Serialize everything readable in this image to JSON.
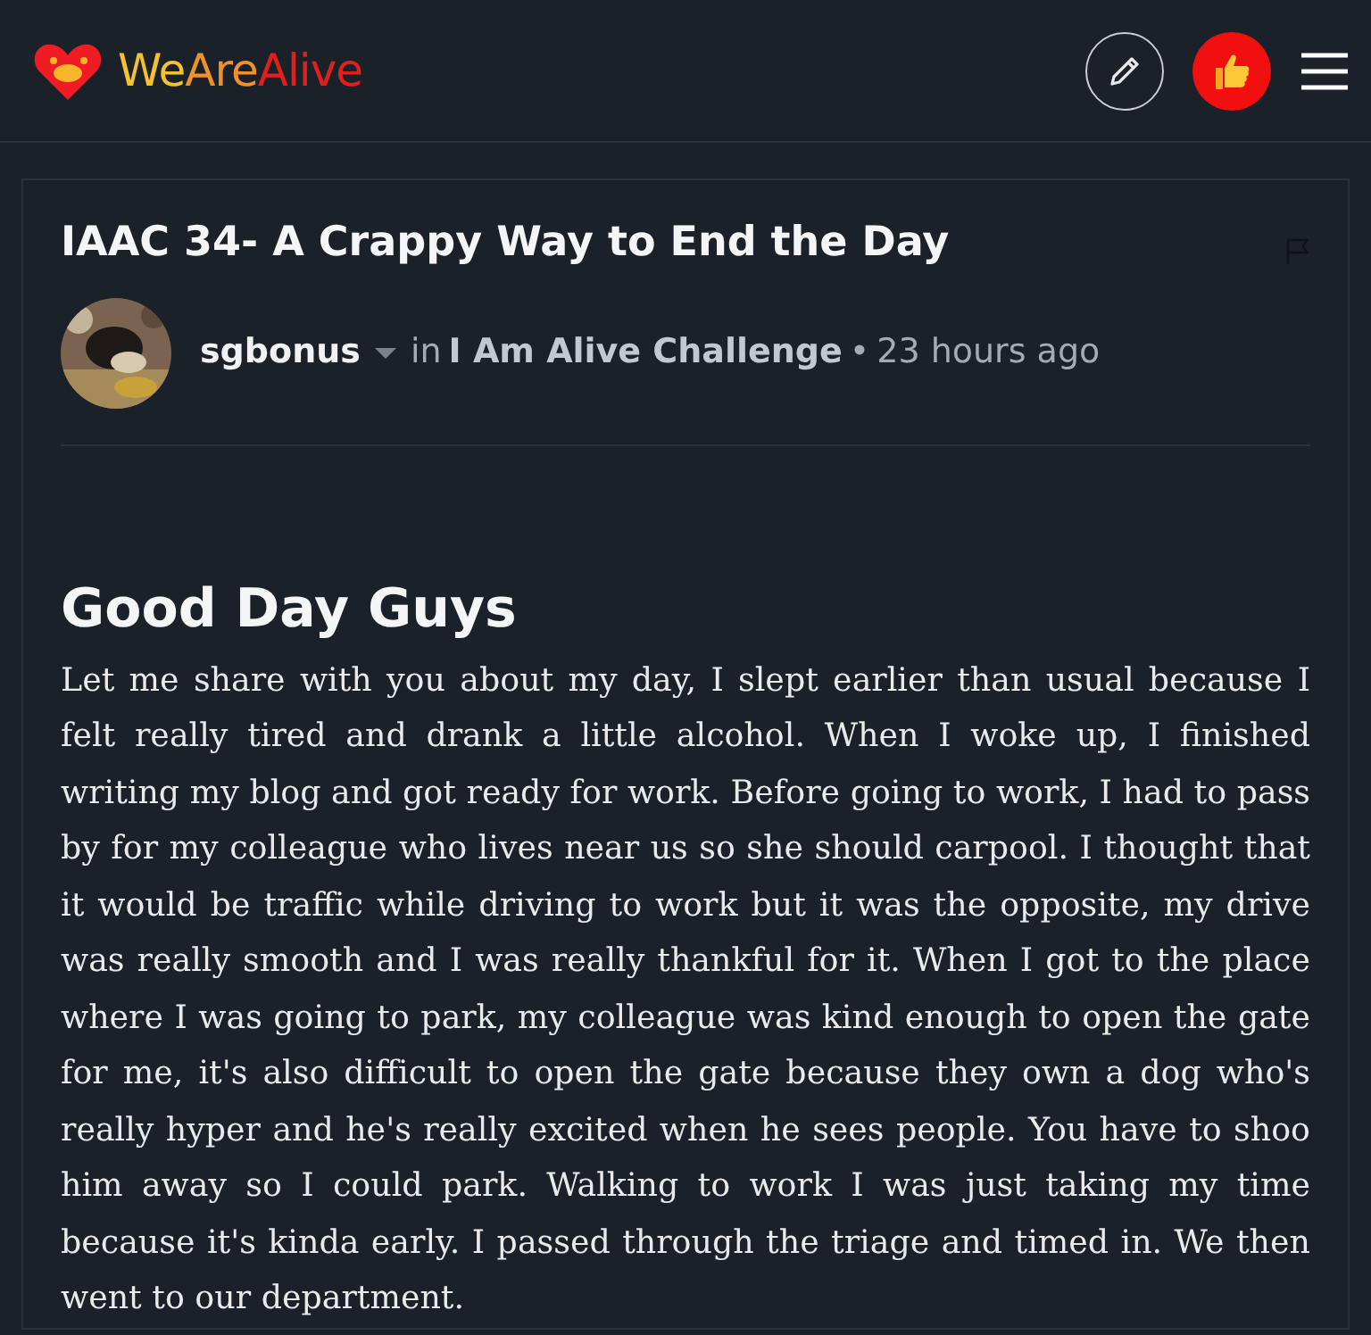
{
  "header": {
    "logo_parts": [
      {
        "text": "We",
        "color": "#f2c230"
      },
      {
        "text": "Are",
        "color": "#f0922a"
      },
      {
        "text": "Alive",
        "color": "#e0201b"
      }
    ]
  },
  "post": {
    "title": "IAAC 34- A Crappy Way to End the Day",
    "author": "sgbonus",
    "in_label": "in",
    "community": "I Am Alive Challenge",
    "separator": "•",
    "time": "23 hours ago",
    "heading": "Good Day Guys",
    "body": "Let me share with you about my day, I slept earlier than usual because I felt really tired and drank a little alcohol. When I woke up, I finished writing my blog and got ready for work. Before going to work, I had to pass by for my colleague who lives near us so she should carpool. I thought that it would be traffic while driving to work but it was the opposite, my drive was really smooth and I was really thankful for it. When I got to the place where I was going to park, my colleague was kind enough to open the gate for me, it's also difficult to open the gate because they own a dog who's really hyper and he's really excited when he sees people. You have to shoo him away so I could park. Walking to work I was just taking my time because it's kinda early. I passed through the triage and timed in. We then went to our department."
  }
}
